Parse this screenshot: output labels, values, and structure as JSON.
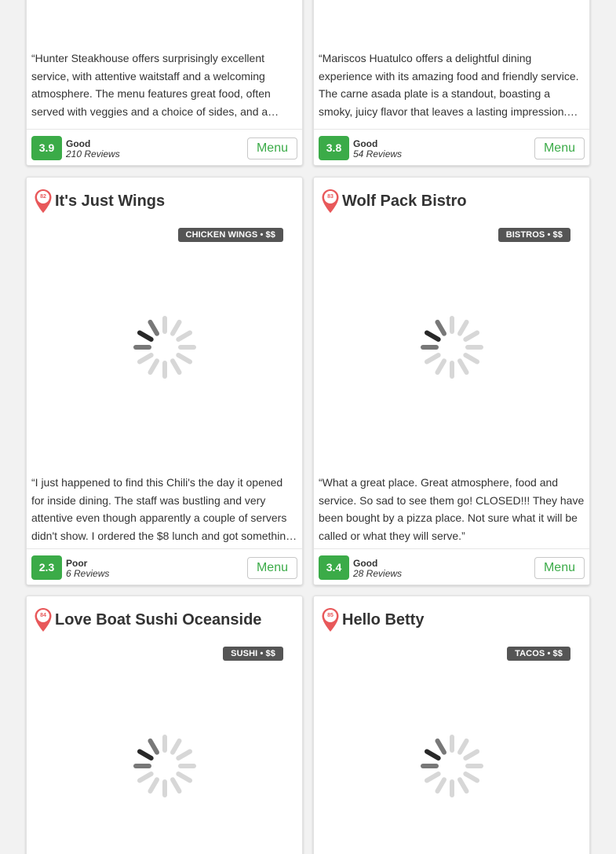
{
  "colors": {
    "accent": "#3bab48",
    "pin": "#e8585a",
    "badge": "#555555"
  },
  "cards": [
    {
      "review": "“Hunter Steakhouse offers surprisingly excellent service, with attentive waitstaff and a welcoming atmosphere. The menu features great food, often served with veggies and a choice of sides, and a…",
      "score": "3.9",
      "rating_label": "Good",
      "reviews": "210 Reviews",
      "menu": "Menu"
    },
    {
      "review": "“Mariscos Huatulco offers a delightful dining experience with its amazing food and friendly service. The carne asada plate is a standout, boasting a smoky, juicy flavor that leaves a lasting impression.…",
      "score": "3.8",
      "rating_label": "Good",
      "reviews": "54 Reviews",
      "menu": "Menu"
    },
    {
      "rank": "82",
      "name": "It's Just Wings",
      "category": "CHICKEN WINGS • $$",
      "review": "“I just happened to find this Chili's the day it opened for inside dining. The staff was bustling and very attentive even though apparently a couple of servers didn't show. I ordered the $8 lunch and got somethin…",
      "score": "2.3",
      "rating_label": "Poor",
      "reviews": "6 Reviews",
      "menu": "Menu"
    },
    {
      "rank": "83",
      "name": "Wolf Pack Bistro",
      "category": "BISTROS • $$",
      "review": "“What a great place. Great atmosphere, food and service. So sad to see them go! CLOSED!!! They have been bought by a pizza place. Not sure what it will be called or what they will serve.”",
      "score": "3.4",
      "rating_label": "Good",
      "reviews": "28 Reviews",
      "menu": "Menu"
    },
    {
      "rank": "84",
      "name": "Love Boat Sushi Oceanside",
      "category": "SUSHI • $$"
    },
    {
      "rank": "85",
      "name": "Hello Betty",
      "category": "TACOS • $$"
    }
  ]
}
